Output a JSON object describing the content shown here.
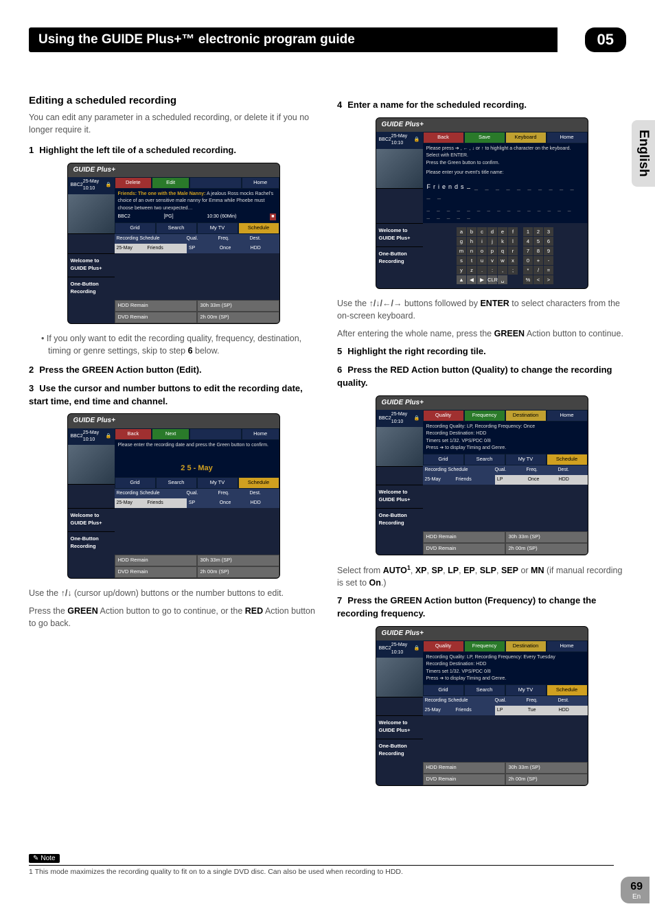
{
  "header": {
    "title": "Using the GUIDE Plus+™ electronic program guide",
    "chapter": "05",
    "side_tab": "English"
  },
  "left": {
    "section_title": "Editing a scheduled recording",
    "intro": "You can edit any parameter in a scheduled recording, or delete it if you no longer require it.",
    "step1_num": "1",
    "step1": "Highlight the left tile of a scheduled recording.",
    "bullet1_pre": "If you only want to edit the recording quality, frequency, destination, timing or genre settings, skip to step ",
    "bullet1_bold": "6",
    "bullet1_post": " below.",
    "step2_num": "2",
    "step2": "Press the GREEN Action button (Edit).",
    "step3_num": "3",
    "step3": "Use the cursor and number buttons to edit the recording date, start time, end time and channel.",
    "after2_a_pre": "Use the ",
    "after2_a_mid": " (cursor up/down) buttons or the number buttons to edit.",
    "after2_b_pre": "Press the ",
    "after2_b_g": "GREEN",
    "after2_b_mid": " Action button to go to continue, or the ",
    "after2_b_r": "RED",
    "after2_b_post": " Action button to go back."
  },
  "right": {
    "step4_num": "4",
    "step4": "Enter a name for the scheduled recording.",
    "after4a_pre": "Use the ",
    "after4a_mid": " buttons followed by ",
    "after4a_enter": "ENTER",
    "after4a_post": " to select characters from the on-screen keyboard.",
    "after4b_pre": "After entering the whole name, press the ",
    "after4b_g": "GREEN",
    "after4b_post": " Action button to continue.",
    "step5_num": "5",
    "step5": "Highlight the right recording tile.",
    "step6_num": "6",
    "step6": "Press the RED Action button (Quality) to change the recording quality.",
    "after6_pre": "Select from ",
    "after6_modes": [
      "AUTO",
      "XP",
      "SP",
      "LP",
      "EP",
      "SLP",
      "SEP",
      "MN"
    ],
    "after6_post_pre": " (if manual recording is set to ",
    "after6_on": "On",
    "after6_post": ".)",
    "step7_num": "7",
    "step7": "Press the GREEN Action button (Frequency) to change the recording frequency."
  },
  "shot_common": {
    "logo": "GUIDE Plus+",
    "channel": "BBC2",
    "datetime": "25-May 10:10",
    "welcome": "Welcome to",
    "gp": "GUIDE Plus+",
    "ob1": "One-Button",
    "ob2": "Recording",
    "tabs": {
      "grid": "Grid",
      "search": "Search",
      "mytv": "My TV",
      "schedule": "Schedule"
    },
    "rs": "Recording Schedule",
    "qual": "Qual.",
    "freq": "Freq.",
    "dest": "Dest.",
    "row_date": "25-May",
    "row_prog": "Friends",
    "row_q": "SP",
    "row_f": "Once",
    "row_d": "HDD",
    "hdd": "HDD Remain",
    "hddv": "30h 33m (SP)",
    "dvd": "DVD Remain",
    "dvdv": "2h 00m (SP)",
    "home": "Home"
  },
  "shot1": {
    "btn_delete": "Delete",
    "btn_edit": "Edit",
    "desc_title": "Friends: The one with the Male Nanny:",
    "desc": "A jealous Ross mocks Rachel's choice of an over sensitive male nanny for Emma while Phoebe must choose between two unexpected…",
    "ch": "BBC2",
    "pg": "[PG]",
    "time": "10:30 (60Min)"
  },
  "shot2": {
    "btn_back": "Back",
    "btn_next": "Next",
    "desc": "Please enter the recording date and press the Green button to confirm.",
    "date": "2 5 - May"
  },
  "shot3": {
    "btn_back": "Back",
    "btn_save": "Save",
    "btn_kbd": "Keyboard",
    "line1": "Please press ➔ , ← , ↓ or ↑ to highlight a character on the keyboard. Select with ENTER.",
    "line2": "Press the Green button to confirm.",
    "line3": "Please enter your event's title name:",
    "typed": "Friends",
    "letters": [
      "a",
      "b",
      "c",
      "d",
      "e",
      "f",
      "g",
      "h",
      "i",
      "j",
      "k",
      "l",
      "m",
      "n",
      "o",
      "p",
      "q",
      "r",
      "s",
      "t",
      "u",
      "v",
      "w",
      "x",
      "y",
      "z",
      ".",
      ":",
      ",",
      ";"
    ],
    "nums": [
      "1",
      "2",
      "3",
      "4",
      "5",
      "6",
      "7",
      "8",
      "9",
      "0",
      "+",
      "-",
      "*",
      "/",
      "=",
      "%",
      "<",
      ">"
    ],
    "nav": [
      "▲",
      "◀",
      "▶",
      "CLR",
      "␣"
    ]
  },
  "shot4": {
    "btn_q": "Quality",
    "btn_f": "Frequency",
    "btn_d": "Destination",
    "l1": "Recording Quality: LP, Recording Frequency: Once",
    "l2": "Recording Destination: HDD",
    "l3": "Timers set 1/32. VPS/PDC 0/8",
    "l4": "Press ➔ to display Timing and Genre.",
    "row_q": "LP"
  },
  "shot5": {
    "btn_q": "Quality",
    "btn_f": "Frequency",
    "btn_d": "Destination",
    "l1": "Recording Quality: LP, Recording Frequency: Every Tuesday",
    "l2": "Recording Destination: HDD",
    "l3": "Timers set 1/32. VPS/PDC 0/8",
    "l4": "Press ➔ to display Timing and Genre.",
    "row_q": "LP",
    "row_f": "Tue"
  },
  "footer": {
    "note_label": "Note",
    "note_text": "1 This mode maximizes the recording quality to fit on to a single DVD disc. Can also be used when recording to HDD.",
    "page_num": "69",
    "page_lang": "En"
  },
  "glyphs": {
    "up": "↑",
    "down": "↓",
    "left": "←",
    "right": "→",
    "updown": "↑/↓",
    "all": "↑/↓/←/→",
    "pencil": "✎",
    "lock": "🔒"
  }
}
